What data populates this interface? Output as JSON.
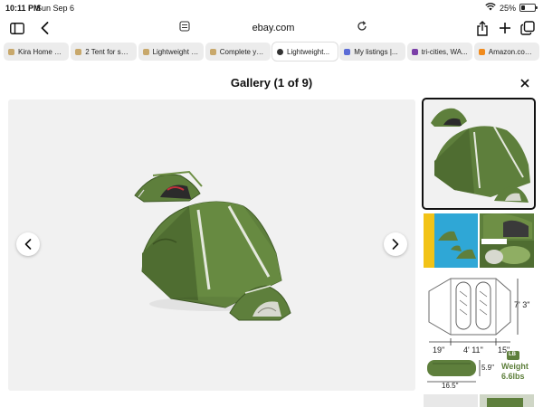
{
  "status": {
    "time": "10:11 PM",
    "date": "Sun Sep 6",
    "battery": "25%",
    "battery_level": 0.25
  },
  "address_bar": {
    "url": "ebay.com"
  },
  "tabs": [
    {
      "label": "Kira Home W...",
      "favicon_color": "#c8a86b",
      "active": false
    },
    {
      "label": "2 Tent for sal...",
      "favicon_color": "#c8a86b",
      "active": false
    },
    {
      "label": "Lightweight 2...",
      "favicon_color": "#c8a86b",
      "active": false
    },
    {
      "label": "Complete you...",
      "favicon_color": "#c8a86b",
      "active": false
    },
    {
      "label": "Lightweight...",
      "favicon_color": "#333333",
      "active": true
    },
    {
      "label": "My listings |...",
      "favicon_color": "#5b6cd6",
      "active": false
    },
    {
      "label": "tri-cities, WA...",
      "favicon_color": "#7b3fa8",
      "active": false
    },
    {
      "label": "Amazon.com...",
      "favicon_color": "#f08a1c",
      "active": false
    }
  ],
  "gallery": {
    "title": "Gallery (1 of 9)"
  },
  "thumbnail_dims": {
    "height": "7' 3\"",
    "width_a": "19\"",
    "width_b": "4' 11\"",
    "width_c": "15\"",
    "pack_len": "16.5\"",
    "pack_dia": "5.9\"",
    "weight_label": "Weight",
    "weight_value": "6.6lbs",
    "lb": "LB"
  },
  "colors": {
    "tent_green": "#5e7f3c",
    "tent_dark": "#3f5a26",
    "tent_light": "#8fae63"
  }
}
